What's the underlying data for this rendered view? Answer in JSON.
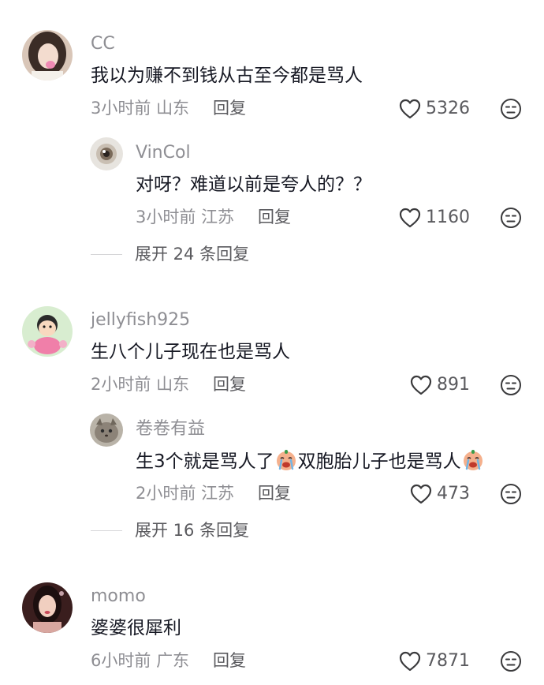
{
  "comments": [
    {
      "username": "CC",
      "text": "我以为赚不到钱从古至今都是骂人",
      "time": "3小时前",
      "location": "山东",
      "reply_label": "回复",
      "likes": "5326",
      "replies": [
        {
          "username": "VinCol",
          "text": "对呀？难道以前是夸人的？？",
          "time": "3小时前",
          "location": "江苏",
          "reply_label": "回复",
          "likes": "1160"
        }
      ],
      "expand_label": "展开 24 条回复"
    },
    {
      "username": "jellyfish925",
      "text": "生八个儿子现在也是骂人",
      "time": "2小时前",
      "location": "山东",
      "reply_label": "回复",
      "likes": "891",
      "replies": [
        {
          "username": "卷卷有益",
          "text_part1": "生3个就是骂人了",
          "text_part2": "双胞胎儿子也是骂人",
          "emoji": "crying-face-emoji",
          "time": "2小时前",
          "location": "江苏",
          "reply_label": "回复",
          "likes": "473"
        }
      ],
      "expand_label": "展开 16 条回复"
    },
    {
      "username": "momo",
      "text": "婆婆很犀利",
      "time": "6小时前",
      "location": "广东",
      "reply_label": "回复",
      "likes": "7871"
    }
  ],
  "icons": {
    "like": "heart-outline-icon",
    "dislike": "unamused-face-icon"
  },
  "colors": {
    "secondary_text": "#8e8e93",
    "primary_text": "#161823"
  }
}
